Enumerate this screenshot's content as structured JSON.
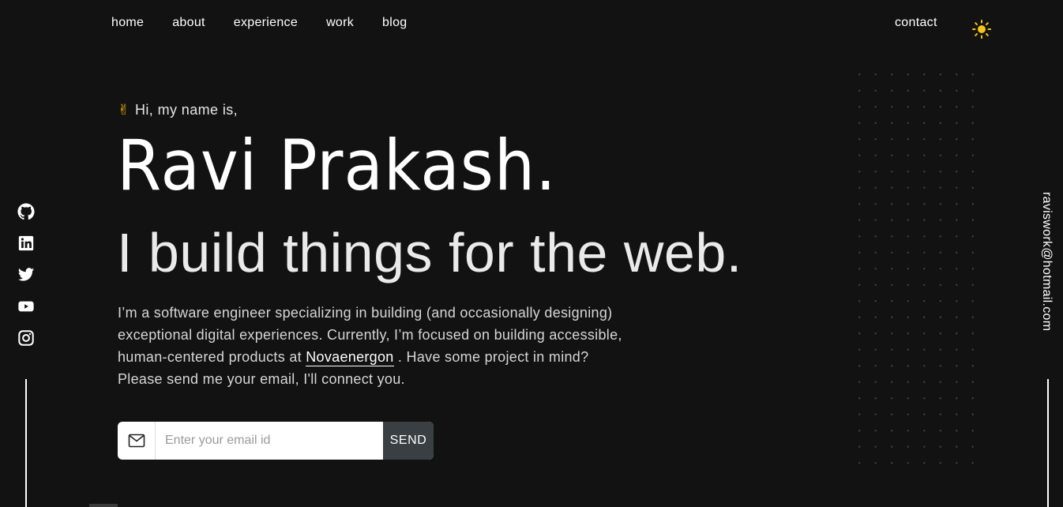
{
  "nav": {
    "links": [
      "home",
      "about",
      "experience",
      "work",
      "blog"
    ],
    "contact": "contact",
    "theme_icon": "sun-icon"
  },
  "colors": {
    "background": "#121212",
    "text": "#ffffff",
    "accent_sun": "#f5c518",
    "send_button": "#3a3f44"
  },
  "social": {
    "icons": [
      "github-icon",
      "linkedin-icon",
      "twitter-icon",
      "youtube-icon",
      "instagram-icon"
    ]
  },
  "side_email": "raviswork@hotmail.com",
  "hero": {
    "greeting_emoji": "✌",
    "greeting": "Hi, my name is,",
    "name": "Ravi Prakash.",
    "tagline": "I build things for the web.",
    "intro_before": "I’m a software engineer specializing in building (and occasionally designing) exceptional digital experiences. Currently, I’m focused on building accessible, human-centered products at ",
    "company": "Novaenergon",
    "intro_after": " . Have some project in mind? Please send me your email, I'll connect you."
  },
  "form": {
    "placeholder": "Enter your email id",
    "value": "",
    "send_label": "SEND",
    "icon": "mail-icon"
  }
}
